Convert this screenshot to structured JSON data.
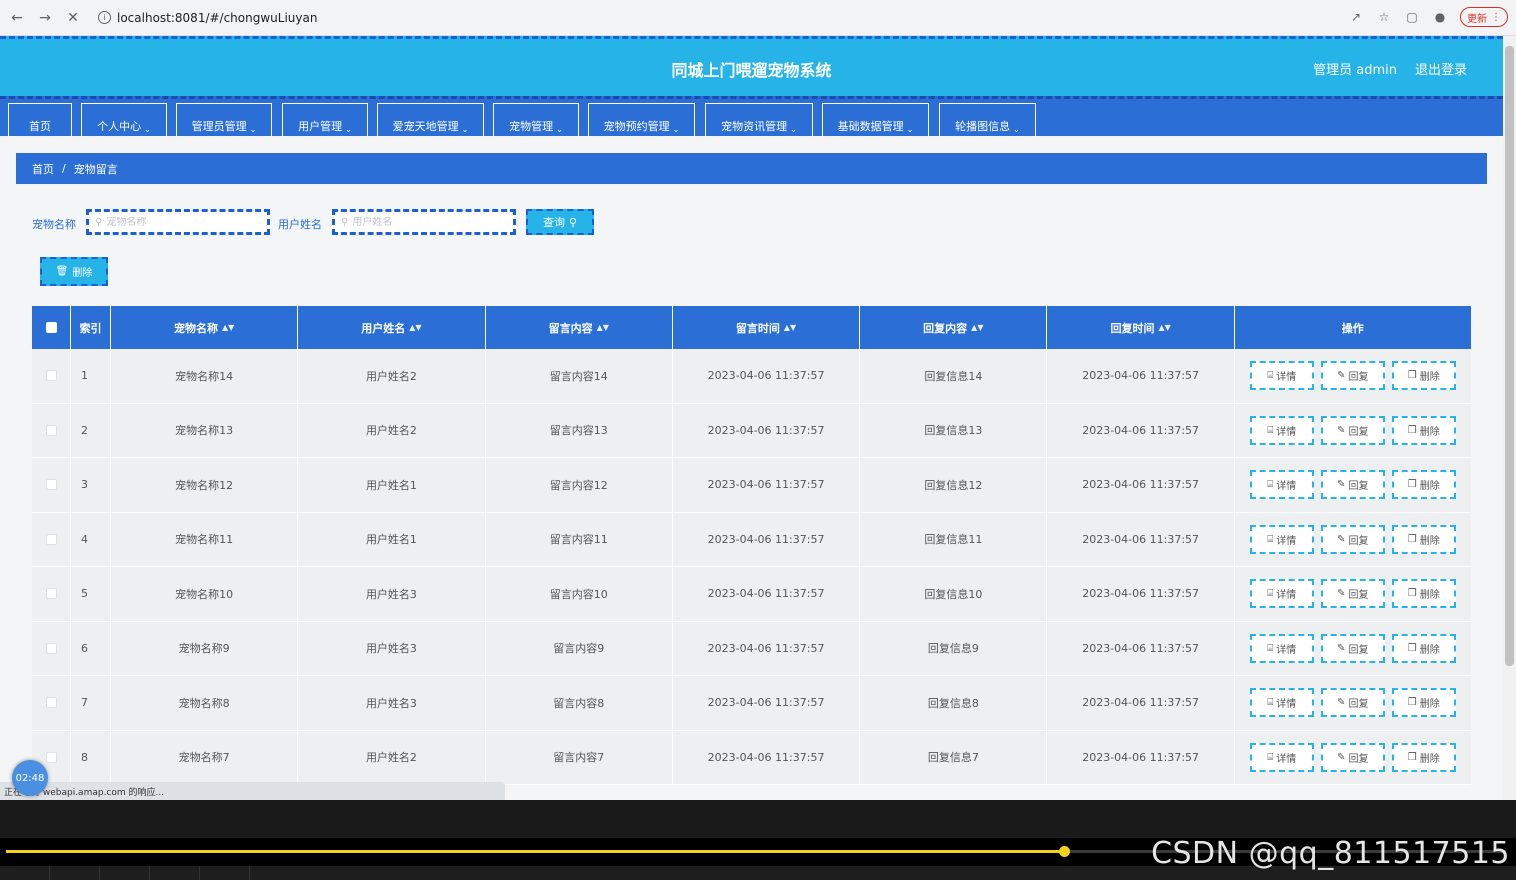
{
  "browser": {
    "url": "localhost:8081/#/chongwuLiuyan",
    "update_label": "更新"
  },
  "header": {
    "title": "同城上门喂遛宠物系统",
    "user": "管理员 admin",
    "logout": "退出登录"
  },
  "menu": [
    {
      "label": "首页",
      "dropdown": false
    },
    {
      "label": "个人中心",
      "dropdown": true
    },
    {
      "label": "管理员管理",
      "dropdown": true
    },
    {
      "label": "用户管理",
      "dropdown": true
    },
    {
      "label": "爱宠天地管理",
      "dropdown": true
    },
    {
      "label": "宠物管理",
      "dropdown": true
    },
    {
      "label": "宠物预约管理",
      "dropdown": true
    },
    {
      "label": "宠物资讯管理",
      "dropdown": true
    },
    {
      "label": "基础数据管理",
      "dropdown": true
    },
    {
      "label": "轮播图信息",
      "dropdown": true
    }
  ],
  "breadcrumb": {
    "home": "首页",
    "sep": "/",
    "current": "宠物留言"
  },
  "search": {
    "pet_label": "宠物名称",
    "pet_placeholder": "宠物名称",
    "user_label": "用户姓名",
    "user_placeholder": "用户姓名",
    "query_label": "查询"
  },
  "actions": {
    "delete_label": "删除"
  },
  "table": {
    "headers": [
      "索引",
      "宠物名称",
      "用户姓名",
      "留言内容",
      "留言时间",
      "回复内容",
      "回复时间",
      "操作"
    ],
    "row_buttons": {
      "detail": "详情",
      "reply": "回复",
      "delete": "删除"
    },
    "rows": [
      {
        "idx": "1",
        "pet": "宠物名称14",
        "user": "用户姓名2",
        "msg": "留言内容14",
        "msg_time": "2023-04-06 11:37:57",
        "reply": "回复信息14",
        "reply_time": "2023-04-06 11:37:57"
      },
      {
        "idx": "2",
        "pet": "宠物名称13",
        "user": "用户姓名2",
        "msg": "留言内容13",
        "msg_time": "2023-04-06 11:37:57",
        "reply": "回复信息13",
        "reply_time": "2023-04-06 11:37:57"
      },
      {
        "idx": "3",
        "pet": "宠物名称12",
        "user": "用户姓名1",
        "msg": "留言内容12",
        "msg_time": "2023-04-06 11:37:57",
        "reply": "回复信息12",
        "reply_time": "2023-04-06 11:37:57"
      },
      {
        "idx": "4",
        "pet": "宠物名称11",
        "user": "用户姓名1",
        "msg": "留言内容11",
        "msg_time": "2023-04-06 11:37:57",
        "reply": "回复信息11",
        "reply_time": "2023-04-06 11:37:57"
      },
      {
        "idx": "5",
        "pet": "宠物名称10",
        "user": "用户姓名3",
        "msg": "留言内容10",
        "msg_time": "2023-04-06 11:37:57",
        "reply": "回复信息10",
        "reply_time": "2023-04-06 11:37:57"
      },
      {
        "idx": "6",
        "pet": "宠物名称9",
        "user": "用户姓名3",
        "msg": "留言内容9",
        "msg_time": "2023-04-06 11:37:57",
        "reply": "回复信息9",
        "reply_time": "2023-04-06 11:37:57"
      },
      {
        "idx": "7",
        "pet": "宠物名称8",
        "user": "用户姓名3",
        "msg": "留言内容8",
        "msg_time": "2023-04-06 11:37:57",
        "reply": "回复信息8",
        "reply_time": "2023-04-06 11:37:57"
      },
      {
        "idx": "8",
        "pet": "宠物名称7",
        "user": "用户姓名2",
        "msg": "留言内容7",
        "msg_time": "2023-04-06 11:37:57",
        "reply": "回复信息7",
        "reply_time": "2023-04-06 11:37:57"
      }
    ]
  },
  "status_bar": {
    "text": "正在等待 webapi.amap.com 的响应..."
  },
  "player": {
    "timer": "02:48",
    "progress": 0.705,
    "watermark": "CSDN @qq_811517515"
  }
}
